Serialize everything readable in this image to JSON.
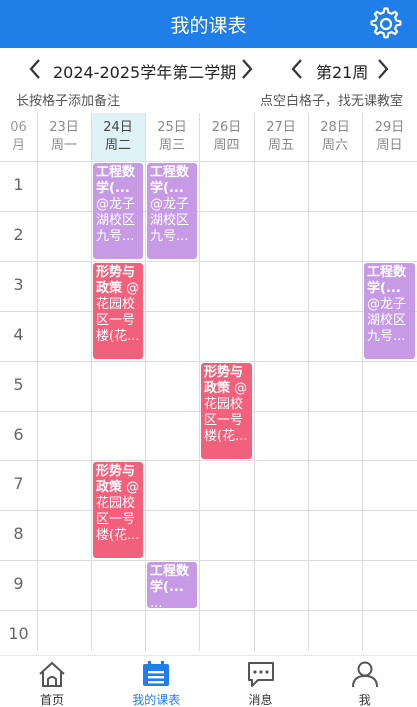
{
  "header": {
    "title": "我的课表"
  },
  "nav": {
    "term": "2024-2025学年第二学期",
    "week": "第21周"
  },
  "hints": {
    "left": "长按格子添加备注",
    "right": "点空白格子，找无课教室"
  },
  "grid": {
    "month": "06",
    "month_unit": "月",
    "days": [
      {
        "date": "23日",
        "weekday": "周一"
      },
      {
        "date": "24日",
        "weekday": "周二"
      },
      {
        "date": "25日",
        "weekday": "周三"
      },
      {
        "date": "26日",
        "weekday": "周四"
      },
      {
        "date": "27日",
        "weekday": "周五"
      },
      {
        "date": "28日",
        "weekday": "周六"
      },
      {
        "date": "29日",
        "weekday": "周日"
      }
    ],
    "periods": [
      "1",
      "2",
      "3",
      "4",
      "5",
      "6",
      "7",
      "8",
      "9",
      "10"
    ]
  },
  "courses": [
    {
      "name": "工程数学(...",
      "location": "@龙子湖校区九号...",
      "day": "周二",
      "start": 1,
      "end": 2
    },
    {
      "name": "工程数学(...",
      "location": "@龙子湖校区九号...",
      "day": "周三",
      "start": 1,
      "end": 2
    },
    {
      "name": "形势与政策",
      "location": "@花园校区一号楼(花...",
      "day": "周二",
      "start": 3,
      "end": 4
    },
    {
      "name": "工程数学(...",
      "location": "@龙子湖校区九号...",
      "day": "周日",
      "start": 3,
      "end": 4
    },
    {
      "name": "形势与政策",
      "location": "@花园校区一号楼(花...",
      "day": "周四",
      "start": 5,
      "end": 6
    },
    {
      "name": "形势与政策",
      "location": "@花园校区一号楼(花...",
      "day": "周二",
      "start": 7,
      "end": 8
    },
    {
      "name": "工程数学(...",
      "location": "...",
      "day": "周三",
      "start": 9,
      "end": 9
    }
  ],
  "tabs": [
    {
      "label": "首页",
      "icon": "home-icon"
    },
    {
      "label": "我的课表",
      "icon": "calendar-icon"
    },
    {
      "label": "消息",
      "icon": "message-icon"
    },
    {
      "label": "我",
      "icon": "user-icon"
    }
  ],
  "colors": {
    "primary": "#1f7ee8",
    "purple": "#c79ae6",
    "pink": "#f2617b",
    "today_bg": "#dff2f8"
  }
}
